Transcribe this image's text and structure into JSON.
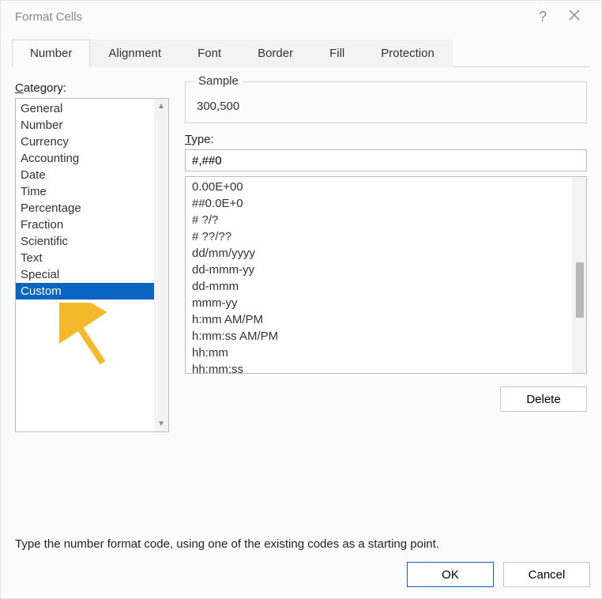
{
  "title": "Format Cells",
  "tabs": [
    "Number",
    "Alignment",
    "Font",
    "Border",
    "Fill",
    "Protection"
  ],
  "active_tab_index": 0,
  "category_label_prefix": "C",
  "category_label_rest": "ategory:",
  "categories": [
    "General",
    "Number",
    "Currency",
    "Accounting",
    "Date",
    "Time",
    "Percentage",
    "Fraction",
    "Scientific",
    "Text",
    "Special",
    "Custom"
  ],
  "selected_category_index": 11,
  "sample_label": "Sample",
  "sample_value": "300,500",
  "type_label_prefix": "T",
  "type_label_rest": "ype:",
  "type_value": "#,##0",
  "format_codes": [
    "0.00E+00",
    "##0.0E+0",
    "# ?/?",
    "# ??/??",
    "dd/mm/yyyy",
    "dd-mmm-yy",
    "dd-mmm",
    "mmm-yy",
    "h:mm AM/PM",
    "h:mm:ss AM/PM",
    "hh:mm",
    "hh:mm:ss"
  ],
  "delete_label": "Delete",
  "hint": "Type the number format code, using one of the existing codes as a starting point.",
  "ok_label": "OK",
  "cancel_label": "Cancel"
}
